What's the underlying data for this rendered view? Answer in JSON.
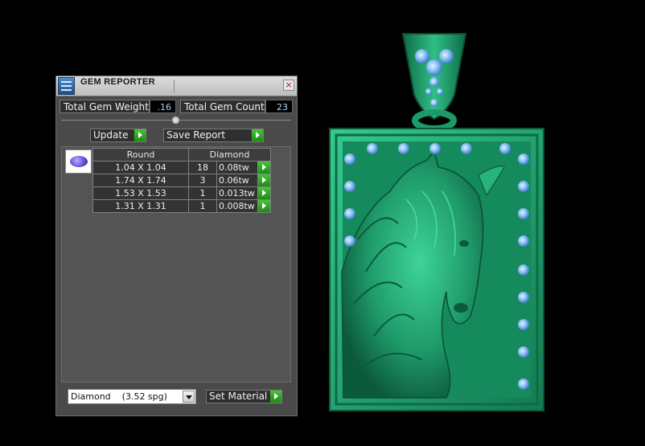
{
  "panel": {
    "title": "GEM REPORTER",
    "close_glyph": "×",
    "total_weight_label": "Total Gem Weight",
    "total_weight_value": ".16",
    "total_count_label": "Total Gem Count",
    "total_count_value": "23",
    "update_label": "Update",
    "save_report_label": "Save Report",
    "table": {
      "headers": [
        "Round",
        "Diamond"
      ],
      "rows": [
        {
          "size": "1.04 X 1.04",
          "count": "18",
          "tw": "0.08tw"
        },
        {
          "size": "1.74 X 1.74",
          "count": "3",
          "tw": "0.06tw"
        },
        {
          "size": "1.53 X 1.53",
          "count": "1",
          "tw": "0.013tw"
        },
        {
          "size": "1.31 X 1.31",
          "count": "1",
          "tw": "0.008tw"
        }
      ]
    },
    "material_value": "Diamond    (3.52 spg)",
    "set_material_label": "Set Material"
  },
  "colors": {
    "panel_bg": "#4a4a4a",
    "go_button": "#2fa226",
    "pendant_green": "#1f9a6a",
    "gem_blue": "#7fb6f0"
  },
  "icons": {
    "app": "gem-reporter-app-icon",
    "close": "close-icon",
    "go": "green-arrow-icon",
    "gem": "round-gem-icon",
    "dropdown": "chevron-down-icon"
  }
}
